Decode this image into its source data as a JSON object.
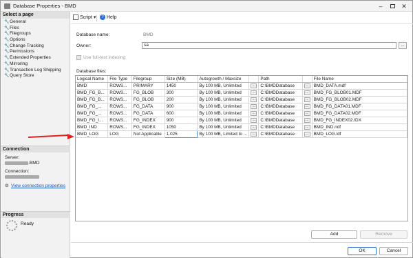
{
  "window": {
    "title": "Database Properties - BMD"
  },
  "sidebar": {
    "header": "Select a page",
    "items": [
      {
        "label": "General"
      },
      {
        "label": "Files"
      },
      {
        "label": "Filegroups"
      },
      {
        "label": "Options"
      },
      {
        "label": "Change Tracking"
      },
      {
        "label": "Permissions"
      },
      {
        "label": "Extended Properties"
      },
      {
        "label": "Mirroring"
      },
      {
        "label": "Transaction Log Shipping"
      },
      {
        "label": "Query Store"
      }
    ],
    "connection": {
      "header": "Connection",
      "server_label": "Server:",
      "server_suffix": ".BMD",
      "connection_label": "Connection:",
      "view_link": "View connection properties"
    },
    "progress": {
      "header": "Progress",
      "status": "Ready"
    }
  },
  "toolbar": {
    "script_label": "Script",
    "help_label": "Help"
  },
  "form": {
    "db_name_label": "Database name:",
    "db_name_value": "BMD",
    "owner_label": "Owner:",
    "owner_value": "sa",
    "owner_button": "...",
    "fulltext_label": "Use full-text indexing",
    "files_label": "Database files:"
  },
  "grid": {
    "columns": [
      "Logical Name",
      "File Type",
      "Filegroup",
      "Size (MB)",
      "Autogrowth / Maxsize",
      "",
      "Path",
      "",
      "File Name"
    ],
    "rows": [
      {
        "name": "BMD",
        "type": "ROWS...",
        "filegroup": "PRIMARY",
        "size": "1450",
        "autogrowth": "By 100 MB, Unlimited",
        "path": "C:\\BMDDatabase",
        "file": "BMD_DATA.mdf"
      },
      {
        "name": "BMD_FG_B...",
        "type": "ROWS...",
        "filegroup": "FG_BLOB",
        "size": "300",
        "autogrowth": "By 100 MB, Unlimited",
        "path": "C:\\BMDDatabase",
        "file": "BMD_FG_BLOB01.MDF"
      },
      {
        "name": "BMD_FG_B...",
        "type": "ROWS...",
        "filegroup": "FG_BLOB",
        "size": "200",
        "autogrowth": "By 100 MB, Unlimited",
        "path": "C:\\BMDDatabase",
        "file": "BMD_FG_BLOB02.MDF"
      },
      {
        "name": "BMD_FG_...",
        "type": "ROWS...",
        "filegroup": "FG_DATA",
        "size": "900",
        "autogrowth": "By 100 MB, Unlimited",
        "path": "C:\\BMDDatabase",
        "file": "BMD_FG_DATA01.MDF"
      },
      {
        "name": "BMD_FG_...",
        "type": "ROWS...",
        "filegroup": "FG_DATA",
        "size": "600",
        "autogrowth": "By 100 MB, Unlimited",
        "path": "C:\\BMDDatabase",
        "file": "BMD_FG_DATA02.MDF"
      },
      {
        "name": "BMD_FG_I...",
        "type": "ROWS...",
        "filegroup": "FG_INDEX",
        "size": "900",
        "autogrowth": "By 100 MB, Unlimited",
        "path": "C:\\BMDDatabase",
        "file": "BMD_FG_INDEX02.IDX"
      },
      {
        "name": "BMD_IND",
        "type": "ROWS...",
        "filegroup": "FG_INDEX",
        "size": "1050",
        "autogrowth": "By 100 MB, Unlimited",
        "path": "C:\\BMDDatabase",
        "file": "BMD_IND.ndf"
      },
      {
        "name": "BMD_LOG",
        "type": "LOG",
        "filegroup": "Not Applicable",
        "size": "1.025",
        "autogrowth": "By 100 MB, Limited to ...",
        "path": "C:\\BMDDatabase",
        "file": "BMD_LOG.ldf"
      }
    ],
    "ellipsis": "..."
  },
  "buttons": {
    "add": "Add",
    "remove": "Remove",
    "ok": "OK",
    "cancel": "Cancel"
  },
  "colors": {
    "accent": "#1a56c9",
    "arrow": "#e02020"
  }
}
